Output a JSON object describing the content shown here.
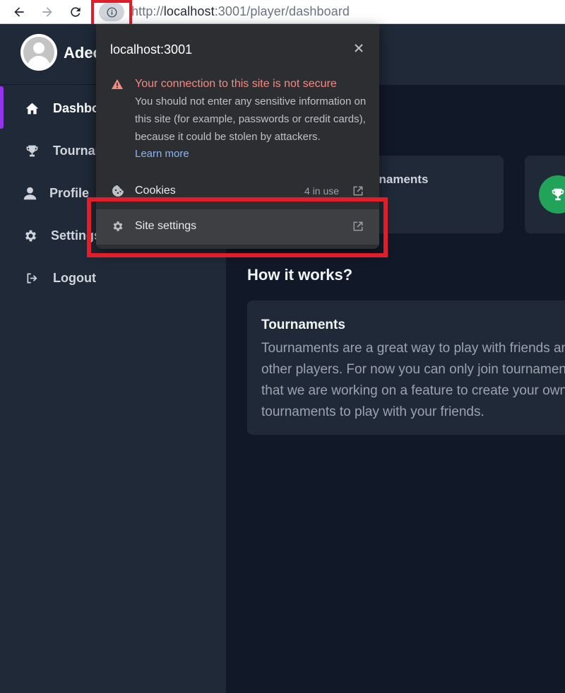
{
  "browser": {
    "url_scheme": "http://",
    "url_host": "localhost",
    "url_rest": ":3001/player/dashboard",
    "icons": [
      "back-arrow-icon",
      "forward-arrow-icon",
      "reload-icon",
      "info-icon"
    ]
  },
  "sidebar": {
    "user_name": "Adeo",
    "items": [
      {
        "label": "Dashboard",
        "icon": "home-icon",
        "active": true
      },
      {
        "label": "Tournaments",
        "icon": "trophy-icon",
        "active": false
      },
      {
        "label": "Profile",
        "icon": "user-icon",
        "active": false
      },
      {
        "label": "Settings",
        "icon": "gear-icon",
        "active": false
      },
      {
        "label": "Logout",
        "icon": "logout-icon",
        "active": false
      }
    ]
  },
  "main": {
    "stat_card_label": "Tournaments",
    "section_title": "How it works?",
    "info_card": {
      "title": "Tournaments",
      "text": "Tournaments are a great way to play with friends and other players. For now you can only join tournaments that we are working on a feature to create your own tournaments to play with your friends."
    }
  },
  "popup": {
    "host": "localhost:3001",
    "warning_title": "Your connection to this site is not secure",
    "warning_body": "You should not enter any sensitive information on this site (for example, passwords or credit cards), because it could be stolen by attackers.",
    "learn_more": "Learn more",
    "cookies_label": "Cookies",
    "cookies_count": "4 in use",
    "site_settings_label": "Site settings"
  },
  "colors": {
    "accent_purple": "#9333ea",
    "highlight_red": "#e11d2a",
    "warning_red": "#f28b82",
    "link_blue": "#8ab4f8",
    "trophy_green": "#22a35a"
  }
}
